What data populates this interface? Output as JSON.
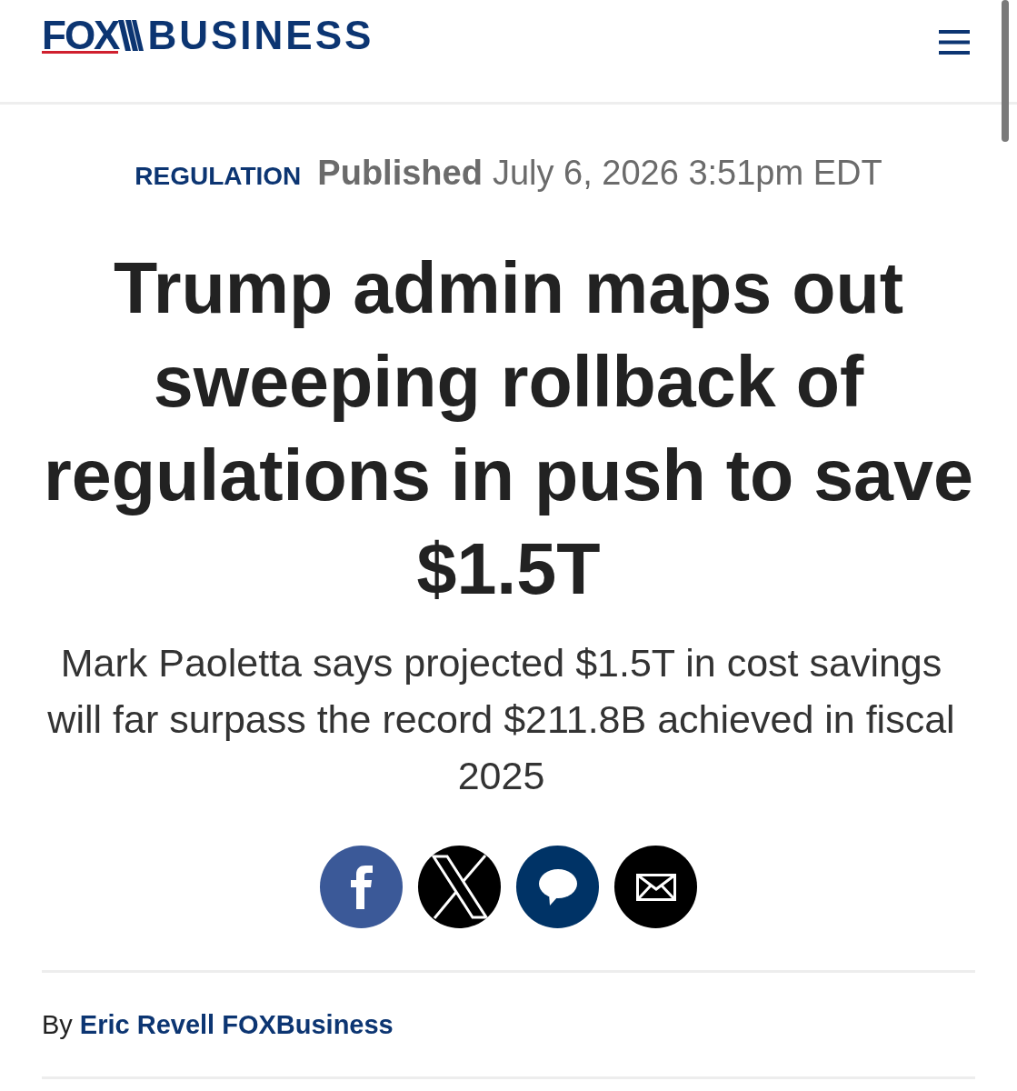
{
  "header": {
    "logo": {
      "left": "FOX",
      "right": "BUSINESS"
    }
  },
  "article": {
    "category": "REGULATION",
    "published_label": "Published",
    "published_time": "July 6, 2026 3:51pm EDT",
    "headline": "Trump admin maps out sweeping rollback of regulations in push to save $1.5T",
    "subheadline": "Mark Paoletta says projected $1.5T in cost savings will far surpass the record $211.8B achieved in fiscal 2025",
    "share_buttons": [
      {
        "kind": "facebook"
      },
      {
        "kind": "x"
      },
      {
        "kind": "comments"
      },
      {
        "kind": "email"
      }
    ],
    "byline": {
      "prefix": "By",
      "author": "Eric Revell",
      "source": "FOXBusiness"
    }
  }
}
